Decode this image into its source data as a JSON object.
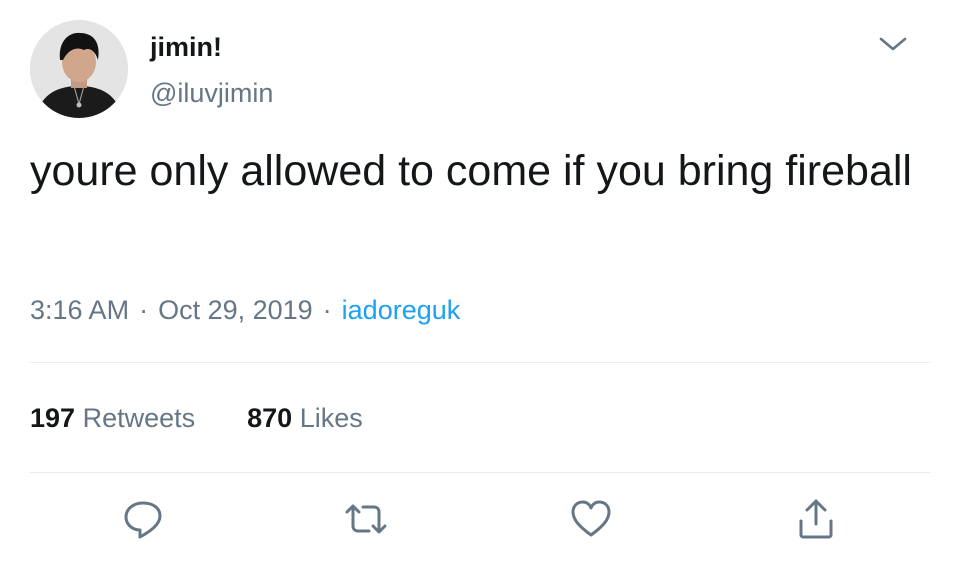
{
  "author": {
    "display_name": "jimin!",
    "handle": "@iluvjimin"
  },
  "tweet": {
    "text": "youre only allowed to come if you bring fireball",
    "time": "3:16 AM",
    "date": "Oct 29, 2019",
    "separator": "·",
    "source": "iadoreguk"
  },
  "stats": {
    "retweets_count": "197",
    "retweets_label": "Retweets",
    "likes_count": "870",
    "likes_label": "Likes"
  },
  "actions": [
    {
      "icon": "reply-icon"
    },
    {
      "icon": "retweet-icon"
    },
    {
      "icon": "like-icon"
    },
    {
      "icon": "share-icon"
    }
  ],
  "colors": {
    "text": "#14171a",
    "secondary": "#657786",
    "link": "#1da1f2",
    "divider": "#e6ecf0"
  }
}
